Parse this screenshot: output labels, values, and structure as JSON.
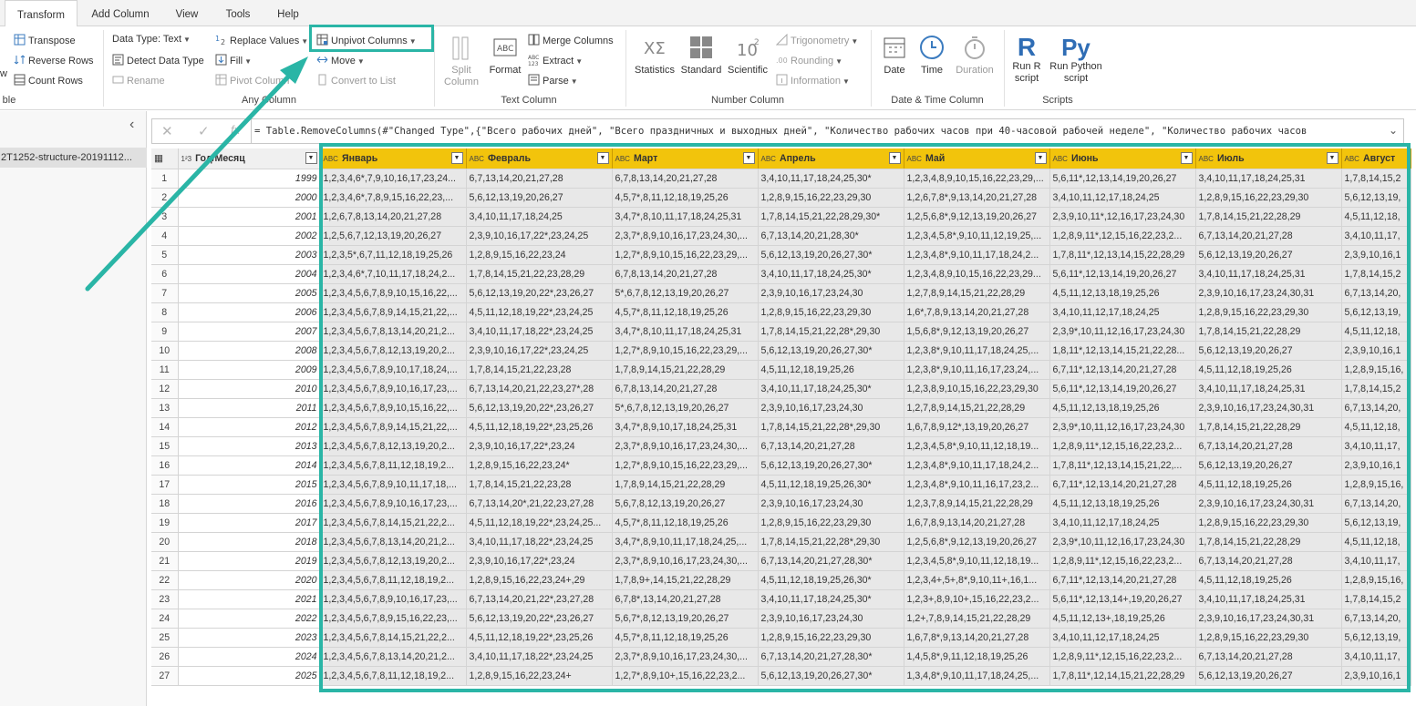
{
  "tabs": [
    "Transform",
    "Add Column",
    "View",
    "Tools",
    "Help"
  ],
  "ribbon": {
    "table_partial": "ble",
    "partial_w": "w",
    "transpose": "Transpose",
    "reverse_rows": "Reverse Rows",
    "count_rows": "Count Rows",
    "data_type": "Data Type: Text",
    "detect_type": "Detect Data Type",
    "rename": "Rename",
    "replace_values": "Replace Values",
    "fill": "Fill",
    "pivot_column": "Pivot Column",
    "unpivot_columns": "Unpivot Columns",
    "move": "Move",
    "convert_to_list": "Convert to List",
    "any_column": "Any Column",
    "split_column": "Split Column",
    "format": "Format",
    "merge_columns": "Merge Columns",
    "extract": "Extract",
    "parse": "Parse",
    "text_column": "Text Column",
    "statistics": "Statistics",
    "standard": "Standard",
    "scientific": "Scientific",
    "trigonometry": "Trigonometry",
    "rounding": "Rounding",
    "information": "Information",
    "number_column": "Number Column",
    "date": "Date",
    "time": "Time",
    "duration": "Duration",
    "date_time_column": "Date & Time Column",
    "run_r": "Run R script",
    "run_python": "Run Python script",
    "scripts": "Scripts"
  },
  "query_pane": {
    "item": "2T1252-structure-20191112..."
  },
  "formula": "= Table.RemoveColumns(#\"Changed Type\",{\"Всего рабочих дней\", \"Всего праздничных и выходных дней\", \"Количество рабочих часов при 40-часовой рабочей неделе\", \"Количество рабочих часов",
  "columns": [
    "Год/Месяц",
    "Январь",
    "Февраль",
    "Март",
    "Апрель",
    "Май",
    "Июнь",
    "Июль",
    "Август"
  ],
  "rows": [
    [
      "1999",
      "1,2,3,4,6*,7,9,10,16,17,23,24...",
      "6,7,13,14,20,21,27,28",
      "6,7,8,13,14,20,21,27,28",
      "3,4,10,11,17,18,24,25,30*",
      "1,2,3,4,8,9,10,15,16,22,23,29,...",
      "5,6,11*,12,13,14,19,20,26,27",
      "3,4,10,11,17,18,24,25,31",
      "1,7,8,14,15,2"
    ],
    [
      "2000",
      "1,2,3,4,6*,7,8,9,15,16,22,23,...",
      "5,6,12,13,19,20,26,27",
      "4,5,7*,8,11,12,18,19,25,26",
      "1,2,8,9,15,16,22,23,29,30",
      "1,2,6,7,8*,9,13,14,20,21,27,28",
      "3,4,10,11,12,17,18,24,25",
      "1,2,8,9,15,16,22,23,29,30",
      "5,6,12,13,19,"
    ],
    [
      "2001",
      "1,2,6,7,8,13,14,20,21,27,28",
      "3,4,10,11,17,18,24,25",
      "3,4,7*,8,10,11,17,18,24,25,31",
      "1,7,8,14,15,21,22,28,29,30*",
      "1,2,5,6,8*,9,12,13,19,20,26,27",
      "2,3,9,10,11*,12,16,17,23,24,30",
      "1,7,8,14,15,21,22,28,29",
      "4,5,11,12,18,"
    ],
    [
      "2002",
      "1,2,5,6,7,12,13,19,20,26,27",
      "2,3,9,10,16,17,22*,23,24,25",
      "2,3,7*,8,9,10,16,17,23,24,30,...",
      "6,7,13,14,20,21,28,30*",
      "1,2,3,4,5,8*,9,10,11,12,19,25,...",
      "1,2,8,9,11*,12,15,16,22,23,2...",
      "6,7,13,14,20,21,27,28",
      "3,4,10,11,17,"
    ],
    [
      "2003",
      "1,2,3,5*,6,7,11,12,18,19,25,26",
      "1,2,8,9,15,16,22,23,24",
      "1,2,7*,8,9,10,15,16,22,23,29,...",
      "5,6,12,13,19,20,26,27,30*",
      "1,2,3,4,8*,9,10,11,17,18,24,2...",
      "1,7,8,11*,12,13,14,15,22,28,29",
      "5,6,12,13,19,20,26,27",
      "2,3,9,10,16,1"
    ],
    [
      "2004",
      "1,2,3,4,6*,7,10,11,17,18,24,2...",
      "1,7,8,14,15,21,22,23,28,29",
      "6,7,8,13,14,20,21,27,28",
      "3,4,10,11,17,18,24,25,30*",
      "1,2,3,4,8,9,10,15,16,22,23,29...",
      "5,6,11*,12,13,14,19,20,26,27",
      "3,4,10,11,17,18,24,25,31",
      "1,7,8,14,15,2"
    ],
    [
      "2005",
      "1,2,3,4,5,6,7,8,9,10,15,16,22,...",
      "5,6,12,13,19,20,22*,23,26,27",
      "5*,6,7,8,12,13,19,20,26,27",
      "2,3,9,10,16,17,23,24,30",
      "1,2,7,8,9,14,15,21,22,28,29",
      "4,5,11,12,13,18,19,25,26",
      "2,3,9,10,16,17,23,24,30,31",
      "6,7,13,14,20,"
    ],
    [
      "2006",
      "1,2,3,4,5,6,7,8,9,14,15,21,22,...",
      "4,5,11,12,18,19,22*,23,24,25",
      "4,5,7*,8,11,12,18,19,25,26",
      "1,2,8,9,15,16,22,23,29,30",
      "1,6*,7,8,9,13,14,20,21,27,28",
      "3,4,10,11,12,17,18,24,25",
      "1,2,8,9,15,16,22,23,29,30",
      "5,6,12,13,19,"
    ],
    [
      "2007",
      "1,2,3,4,5,6,7,8,13,14,20,21,2...",
      "3,4,10,11,17,18,22*,23,24,25",
      "3,4,7*,8,10,11,17,18,24,25,31",
      "1,7,8,14,15,21,22,28*,29,30",
      "1,5,6,8*,9,12,13,19,20,26,27",
      "2,3,9*,10,11,12,16,17,23,24,30",
      "1,7,8,14,15,21,22,28,29",
      "4,5,11,12,18,"
    ],
    [
      "2008",
      "1,2,3,4,5,6,7,8,12,13,19,20,2...",
      "2,3,9,10,16,17,22*,23,24,25",
      "1,2,7*,8,9,10,15,16,22,23,29,...",
      "5,6,12,13,19,20,26,27,30*",
      "1,2,3,8*,9,10,11,17,18,24,25,...",
      "1,8,11*,12,13,14,15,21,22,28...",
      "5,6,12,13,19,20,26,27",
      "2,3,9,10,16,1"
    ],
    [
      "2009",
      "1,2,3,4,5,6,7,8,9,10,17,18,24,...",
      "1,7,8,14,15,21,22,23,28",
      "1,7,8,9,14,15,21,22,28,29",
      "4,5,11,12,18,19,25,26",
      "1,2,3,8*,9,10,11,16,17,23,24,...",
      "6,7,11*,12,13,14,20,21,27,28",
      "4,5,11,12,18,19,25,26",
      "1,2,8,9,15,16,"
    ],
    [
      "2010",
      "1,2,3,4,5,6,7,8,9,10,16,17,23,...",
      "6,7,13,14,20,21,22,23,27*,28",
      "6,7,8,13,14,20,21,27,28",
      "3,4,10,11,17,18,24,25,30*",
      "1,2,3,8,9,10,15,16,22,23,29,30",
      "5,6,11*,12,13,14,19,20,26,27",
      "3,4,10,11,17,18,24,25,31",
      "1,7,8,14,15,2"
    ],
    [
      "2011",
      "1,2,3,4,5,6,7,8,9,10,15,16,22,...",
      "5,6,12,13,19,20,22*,23,26,27",
      "5*,6,7,8,12,13,19,20,26,27",
      "2,3,9,10,16,17,23,24,30",
      "1,2,7,8,9,14,15,21,22,28,29",
      "4,5,11,12,13,18,19,25,26",
      "2,3,9,10,16,17,23,24,30,31",
      "6,7,13,14,20,"
    ],
    [
      "2012",
      "1,2,3,4,5,6,7,8,9,14,15,21,22,...",
      "4,5,11,12,18,19,22*,23,25,26",
      "3,4,7*,8,9,10,17,18,24,25,31",
      "1,7,8,14,15,21,22,28*,29,30",
      "1,6,7,8,9,12*,13,19,20,26,27",
      "2,3,9*,10,11,12,16,17,23,24,30",
      "1,7,8,14,15,21,22,28,29",
      "4,5,11,12,18,"
    ],
    [
      "2013",
      "1,2,3,4,5,6,7,8,12,13,19,20,2...",
      "2,3,9,10,16,17,22*,23,24",
      "2,3,7*,8,9,10,16,17,23,24,30,...",
      "6,7,13,14,20,21,27,28",
      "1,2,3,4,5,8*,9,10,11,12,18,19...",
      "1,2,8,9,11*,12,15,16,22,23,2...",
      "6,7,13,14,20,21,27,28",
      "3,4,10,11,17,"
    ],
    [
      "2014",
      "1,2,3,4,5,6,7,8,11,12,18,19,2...",
      "1,2,8,9,15,16,22,23,24*",
      "1,2,7*,8,9,10,15,16,22,23,29,...",
      "5,6,12,13,19,20,26,27,30*",
      "1,2,3,4,8*,9,10,11,17,18,24,2...",
      "1,7,8,11*,12,13,14,15,21,22,...",
      "5,6,12,13,19,20,26,27",
      "2,3,9,10,16,1"
    ],
    [
      "2015",
      "1,2,3,4,5,6,7,8,9,10,11,17,18,...",
      "1,7,8,14,15,21,22,23,28",
      "1,7,8,9,14,15,21,22,28,29",
      "4,5,11,12,18,19,25,26,30*",
      "1,2,3,4,8*,9,10,11,16,17,23,2...",
      "6,7,11*,12,13,14,20,21,27,28",
      "4,5,11,12,18,19,25,26",
      "1,2,8,9,15,16,"
    ],
    [
      "2016",
      "1,2,3,4,5,6,7,8,9,10,16,17,23,...",
      "6,7,13,14,20*,21,22,23,27,28",
      "5,6,7,8,12,13,19,20,26,27",
      "2,3,9,10,16,17,23,24,30",
      "1,2,3,7,8,9,14,15,21,22,28,29",
      "4,5,11,12,13,18,19,25,26",
      "2,3,9,10,16,17,23,24,30,31",
      "6,7,13,14,20,"
    ],
    [
      "2017",
      "1,2,3,4,5,6,7,8,14,15,21,22,2...",
      "4,5,11,12,18,19,22*,23,24,25...",
      "4,5,7*,8,11,12,18,19,25,26",
      "1,2,8,9,15,16,22,23,29,30",
      "1,6,7,8,9,13,14,20,21,27,28",
      "3,4,10,11,12,17,18,24,25",
      "1,2,8,9,15,16,22,23,29,30",
      "5,6,12,13,19,"
    ],
    [
      "2018",
      "1,2,3,4,5,6,7,8,13,14,20,21,2...",
      "3,4,10,11,17,18,22*,23,24,25",
      "3,4,7*,8,9,10,11,17,18,24,25,...",
      "1,7,8,14,15,21,22,28*,29,30",
      "1,2,5,6,8*,9,12,13,19,20,26,27",
      "2,3,9*,10,11,12,16,17,23,24,30",
      "1,7,8,14,15,21,22,28,29",
      "4,5,11,12,18,"
    ],
    [
      "2019",
      "1,2,3,4,5,6,7,8,12,13,19,20,2...",
      "2,3,9,10,16,17,22*,23,24",
      "2,3,7*,8,9,10,16,17,23,24,30,...",
      "6,7,13,14,20,21,27,28,30*",
      "1,2,3,4,5,8*,9,10,11,12,18,19...",
      "1,2,8,9,11*,12,15,16,22,23,2...",
      "6,7,13,14,20,21,27,28",
      "3,4,10,11,17,"
    ],
    [
      "2020",
      "1,2,3,4,5,6,7,8,11,12,18,19,2...",
      "1,2,8,9,15,16,22,23,24+,29",
      "1,7,8,9+,14,15,21,22,28,29",
      "4,5,11,12,18,19,25,26,30*",
      "1,2,3,4+,5+,8*,9,10,11+,16,1...",
      "6,7,11*,12,13,14,20,21,27,28",
      "4,5,11,12,18,19,25,26",
      "1,2,8,9,15,16,"
    ],
    [
      "2021",
      "1,2,3,4,5,6,7,8,9,10,16,17,23,...",
      "6,7,13,14,20,21,22*,23,27,28",
      "6,7,8*,13,14,20,21,27,28",
      "3,4,10,11,17,18,24,25,30*",
      "1,2,3+,8,9,10+,15,16,22,23,2...",
      "5,6,11*,12,13,14+,19,20,26,27",
      "3,4,10,11,17,18,24,25,31",
      "1,7,8,14,15,2"
    ],
    [
      "2022",
      "1,2,3,4,5,6,7,8,9,15,16,22,23,...",
      "5,6,12,13,19,20,22*,23,26,27",
      "5,6,7*,8,12,13,19,20,26,27",
      "2,3,9,10,16,17,23,24,30",
      "1,2+,7,8,9,14,15,21,22,28,29",
      "4,5,11,12,13+,18,19,25,26",
      "2,3,9,10,16,17,23,24,30,31",
      "6,7,13,14,20,"
    ],
    [
      "2023",
      "1,2,3,4,5,6,7,8,14,15,21,22,2...",
      "4,5,11,12,18,19,22*,23,25,26",
      "4,5,7*,8,11,12,18,19,25,26",
      "1,2,8,9,15,16,22,23,29,30",
      "1,6,7,8*,9,13,14,20,21,27,28",
      "3,4,10,11,12,17,18,24,25",
      "1,2,8,9,15,16,22,23,29,30",
      "5,6,12,13,19,"
    ],
    [
      "2024",
      "1,2,3,4,5,6,7,8,13,14,20,21,2...",
      "3,4,10,11,17,18,22*,23,24,25",
      "2,3,7*,8,9,10,16,17,23,24,30,...",
      "6,7,13,14,20,21,27,28,30*",
      "1,4,5,8*,9,11,12,18,19,25,26",
      "1,2,8,9,11*,12,15,16,22,23,2...",
      "6,7,13,14,20,21,27,28",
      "3,4,10,11,17,"
    ],
    [
      "2025",
      "1,2,3,4,5,6,7,8,11,12,18,19,2...",
      "1,2,8,9,15,16,22,23,24+",
      "1,2,7*,8,9,10+,15,16,22,23,2...",
      "5,6,12,13,19,20,26,27,30*",
      "1,3,4,8*,9,10,11,17,18,24,25,...",
      "1,7,8,11*,12,14,15,21,22,28,29",
      "5,6,12,13,19,20,26,27",
      "2,3,9,10,16,1"
    ]
  ],
  "colors": {
    "accent": "#2ab5a6",
    "selected_header": "#f2c40c"
  }
}
